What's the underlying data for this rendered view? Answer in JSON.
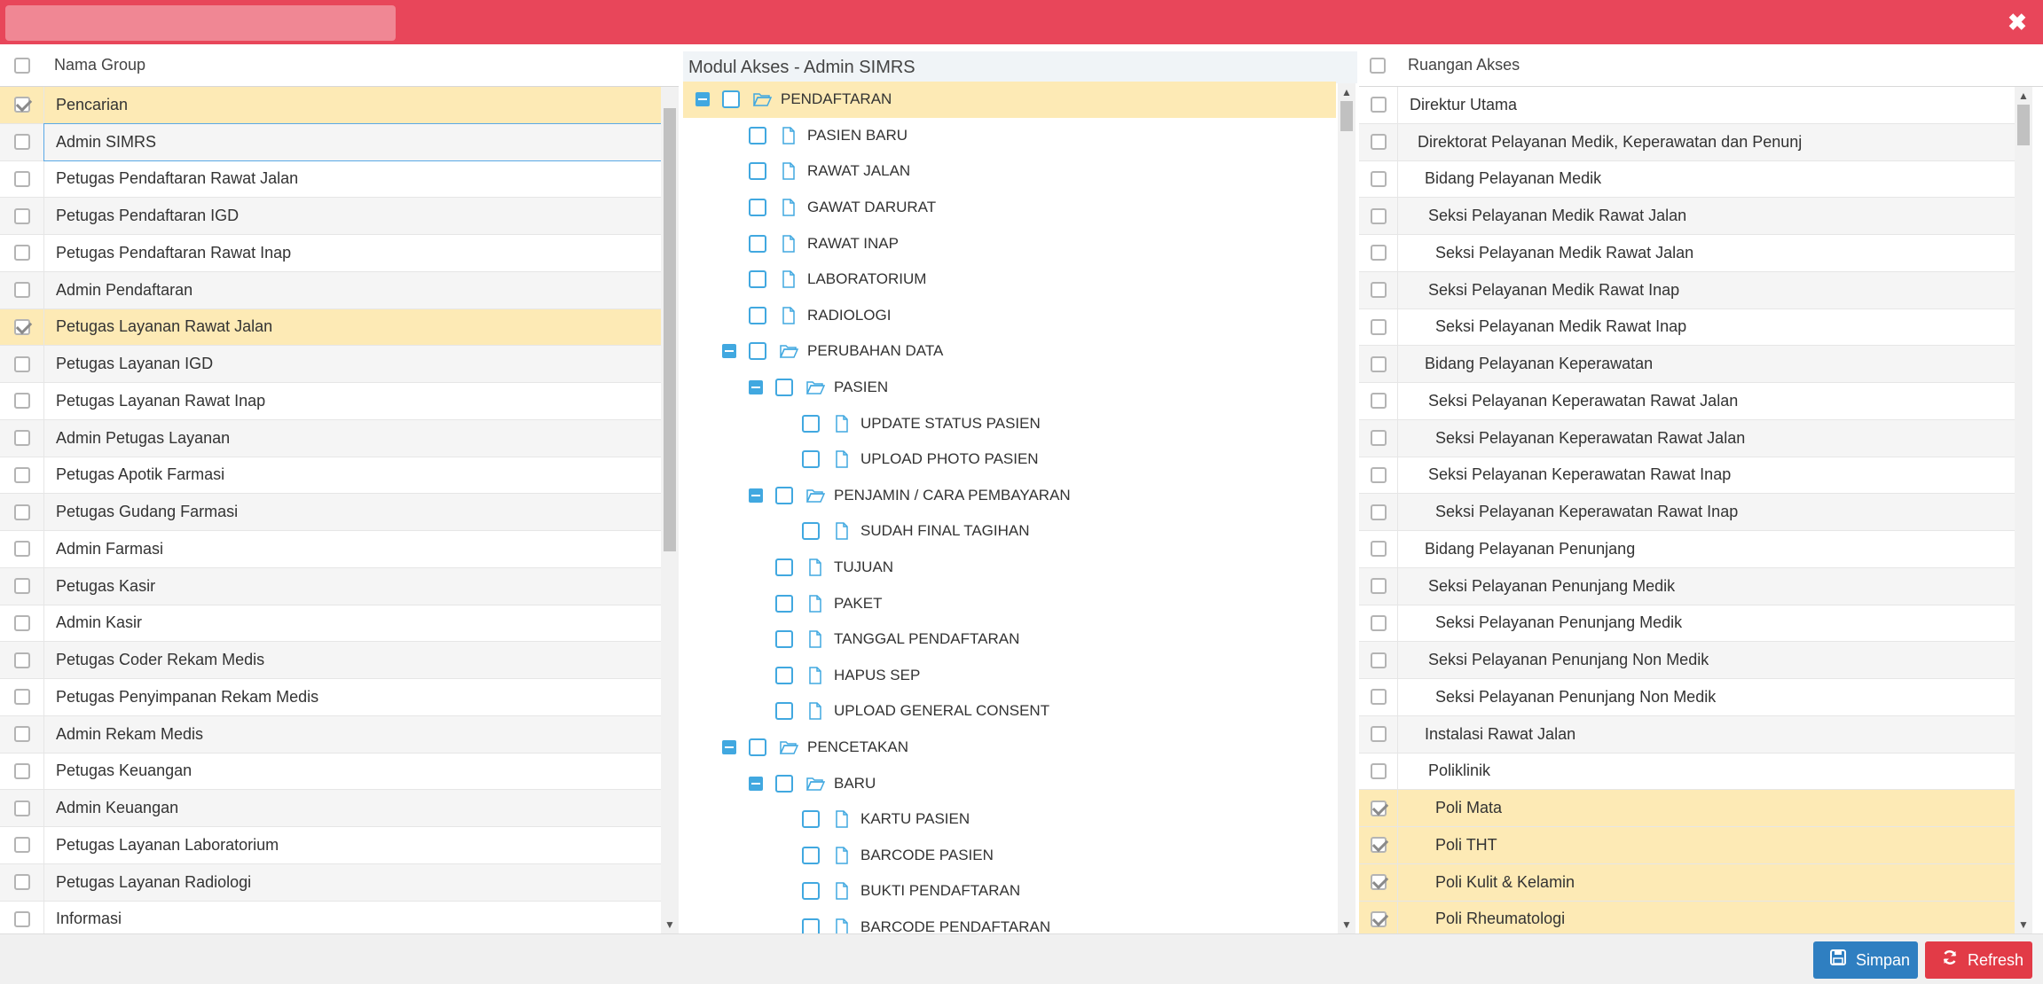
{
  "window": {
    "close_symbol": "✖"
  },
  "left_panel": {
    "header": "Nama Group",
    "items": [
      {
        "label": "Pencarian",
        "checked": true,
        "selected": true
      },
      {
        "label": "Admin SIMRS",
        "checked": false,
        "focused": true
      },
      {
        "label": "Petugas Pendaftaran Rawat Jalan",
        "checked": false
      },
      {
        "label": "Petugas Pendaftaran IGD",
        "checked": false
      },
      {
        "label": "Petugas Pendaftaran Rawat Inap",
        "checked": false
      },
      {
        "label": "Admin Pendaftaran",
        "checked": false
      },
      {
        "label": "Petugas Layanan Rawat Jalan",
        "checked": true,
        "selected": true
      },
      {
        "label": "Petugas Layanan IGD",
        "checked": false
      },
      {
        "label": "Petugas Layanan Rawat Inap",
        "checked": false
      },
      {
        "label": "Admin Petugas Layanan",
        "checked": false
      },
      {
        "label": "Petugas Apotik Farmasi",
        "checked": false
      },
      {
        "label": "Petugas Gudang Farmasi",
        "checked": false
      },
      {
        "label": "Admin Farmasi",
        "checked": false
      },
      {
        "label": "Petugas Kasir",
        "checked": false
      },
      {
        "label": "Admin Kasir",
        "checked": false
      },
      {
        "label": "Petugas Coder Rekam Medis",
        "checked": false
      },
      {
        "label": "Petugas Penyimpanan Rekam Medis",
        "checked": false
      },
      {
        "label": "Admin Rekam Medis",
        "checked": false
      },
      {
        "label": "Petugas Keuangan",
        "checked": false
      },
      {
        "label": "Admin Keuangan",
        "checked": false
      },
      {
        "label": "Petugas Layanan Laboratorium",
        "checked": false
      },
      {
        "label": "Petugas Layanan Radiologi",
        "checked": false
      },
      {
        "label": "Informasi",
        "checked": false
      }
    ]
  },
  "middle_panel": {
    "header": "Modul Akses - Admin SIMRS",
    "tree": [
      {
        "label": "PENDAFTARAN",
        "level": 0,
        "type": "folder",
        "expanded": true,
        "selected": true
      },
      {
        "label": "PASIEN BARU",
        "level": 1,
        "type": "file"
      },
      {
        "label": "RAWAT JALAN",
        "level": 1,
        "type": "file"
      },
      {
        "label": "GAWAT DARURAT",
        "level": 1,
        "type": "file"
      },
      {
        "label": "RAWAT INAP",
        "level": 1,
        "type": "file"
      },
      {
        "label": "LABORATORIUM",
        "level": 1,
        "type": "file"
      },
      {
        "label": "RADIOLOGI",
        "level": 1,
        "type": "file"
      },
      {
        "label": "PERUBAHAN DATA",
        "level": 1,
        "type": "folder",
        "expanded": true
      },
      {
        "label": "PASIEN",
        "level": 2,
        "type": "folder",
        "expanded": true
      },
      {
        "label": "UPDATE STATUS PASIEN",
        "level": 3,
        "type": "file"
      },
      {
        "label": "UPLOAD PHOTO PASIEN",
        "level": 3,
        "type": "file"
      },
      {
        "label": "PENJAMIN / CARA PEMBAYARAN",
        "level": 2,
        "type": "folder",
        "expanded": true
      },
      {
        "label": "SUDAH FINAL TAGIHAN",
        "level": 3,
        "type": "file"
      },
      {
        "label": "TUJUAN",
        "level": 2,
        "type": "file"
      },
      {
        "label": "PAKET",
        "level": 2,
        "type": "file"
      },
      {
        "label": "TANGGAL PENDAFTARAN",
        "level": 2,
        "type": "file"
      },
      {
        "label": "HAPUS SEP",
        "level": 2,
        "type": "file"
      },
      {
        "label": "UPLOAD GENERAL CONSENT",
        "level": 2,
        "type": "file"
      },
      {
        "label": "PENCETAKAN",
        "level": 1,
        "type": "folder",
        "expanded": true
      },
      {
        "label": "BARU",
        "level": 2,
        "type": "folder",
        "expanded": true
      },
      {
        "label": "KARTU PASIEN",
        "level": 3,
        "type": "file"
      },
      {
        "label": "BARCODE PASIEN",
        "level": 3,
        "type": "file"
      },
      {
        "label": "BUKTI PENDAFTARAN",
        "level": 3,
        "type": "file"
      },
      {
        "label": "BARCODE PENDAFTARAN",
        "level": 3,
        "type": "file"
      }
    ]
  },
  "right_panel": {
    "header": "Ruangan Akses",
    "items": [
      {
        "label": "Direktur Utama",
        "indent": 0,
        "checked": false
      },
      {
        "label": "Direktorat Pelayanan Medik, Keperawatan dan Penunj",
        "indent": 1,
        "checked": false
      },
      {
        "label": "Bidang Pelayanan Medik",
        "indent": 2,
        "checked": false
      },
      {
        "label": "Seksi Pelayanan Medik Rawat Jalan",
        "indent": 3,
        "checked": false
      },
      {
        "label": "Seksi Pelayanan Medik Rawat Jalan",
        "indent": 4,
        "checked": false
      },
      {
        "label": "Seksi Pelayanan Medik Rawat Inap",
        "indent": 3,
        "checked": false
      },
      {
        "label": "Seksi Pelayanan Medik Rawat Inap",
        "indent": 4,
        "checked": false
      },
      {
        "label": "Bidang Pelayanan Keperawatan",
        "indent": 2,
        "checked": false
      },
      {
        "label": "Seksi Pelayanan Keperawatan Rawat Jalan",
        "indent": 3,
        "checked": false
      },
      {
        "label": "Seksi Pelayanan Keperawatan Rawat Jalan",
        "indent": 4,
        "checked": false
      },
      {
        "label": "Seksi Pelayanan Keperawatan Rawat Inap",
        "indent": 3,
        "checked": false
      },
      {
        "label": "Seksi Pelayanan Keperawatan Rawat Inap",
        "indent": 4,
        "checked": false
      },
      {
        "label": "Bidang Pelayanan Penunjang",
        "indent": 2,
        "checked": false
      },
      {
        "label": "Seksi Pelayanan Penunjang Medik",
        "indent": 3,
        "checked": false
      },
      {
        "label": "Seksi Pelayanan Penunjang Medik",
        "indent": 4,
        "checked": false
      },
      {
        "label": "Seksi Pelayanan Penunjang Non Medik",
        "indent": 3,
        "checked": false
      },
      {
        "label": "Seksi Pelayanan Penunjang Non Medik",
        "indent": 4,
        "checked": false
      },
      {
        "label": "Instalasi Rawat Jalan",
        "indent": 2,
        "checked": false
      },
      {
        "label": "Poliklinik",
        "indent": 3,
        "checked": false
      },
      {
        "label": "Poli Mata",
        "indent": 4,
        "checked": true,
        "selected": true
      },
      {
        "label": "Poli THT",
        "indent": 4,
        "checked": true,
        "selected": true
      },
      {
        "label": "Poli Kulit & Kelamin",
        "indent": 4,
        "checked": true,
        "selected": true
      },
      {
        "label": "Poli Rheumatologi",
        "indent": 4,
        "checked": true,
        "selected": true
      }
    ]
  },
  "footer": {
    "save_label": "Simpan",
    "refresh_label": "Refresh"
  },
  "colors": {
    "titlebar": "#e8465a",
    "selected_row": "#fdeab5",
    "accent_blue": "#41a8e0",
    "save_button": "#2f7fc1",
    "refresh_button": "#e23b47"
  }
}
